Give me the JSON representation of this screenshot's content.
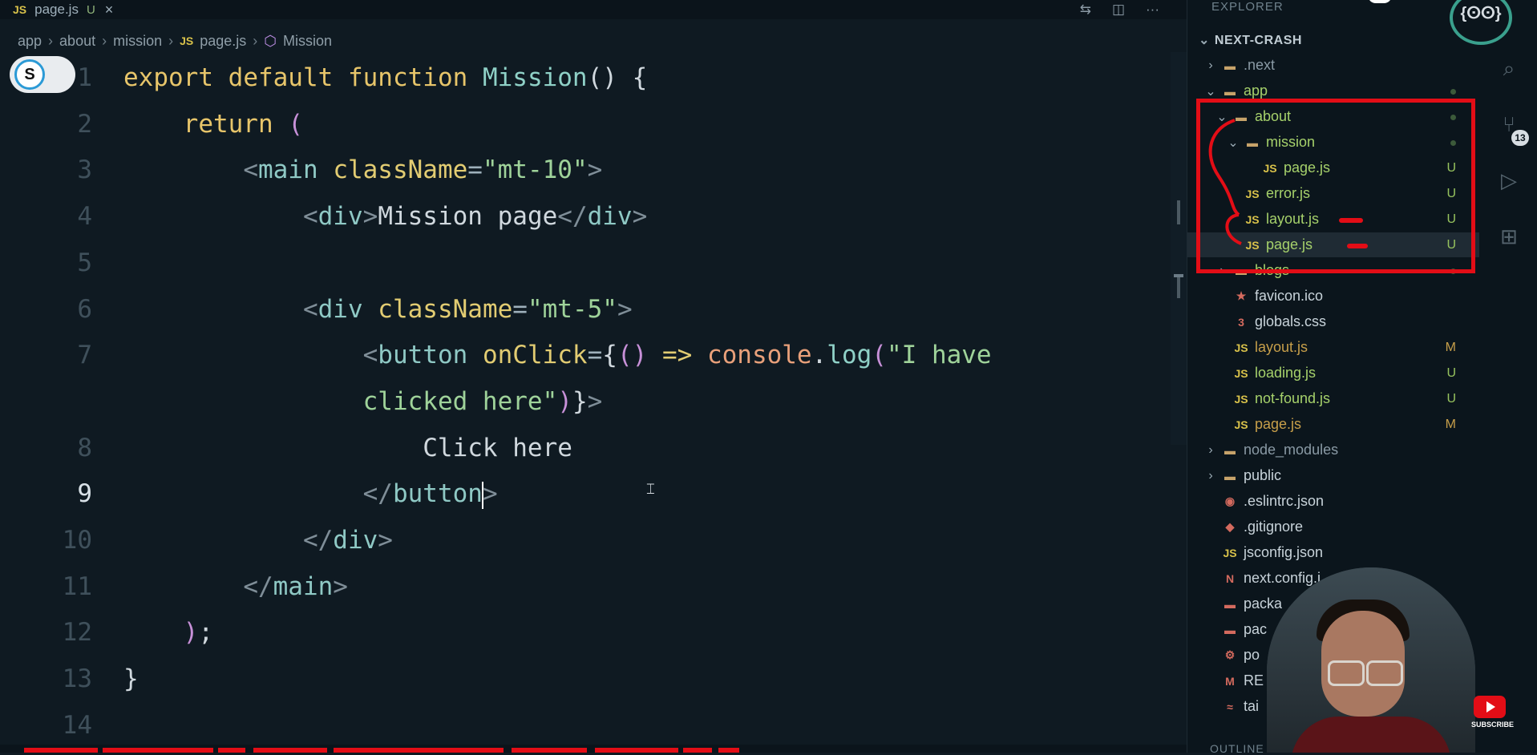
{
  "tab": {
    "icon": "JS",
    "name": "page.js",
    "status": "U",
    "close": "×"
  },
  "tab_actions": [
    "compare-icon",
    "split-editor-icon",
    "more-icon"
  ],
  "breadcrumb": [
    {
      "label": "app"
    },
    {
      "label": "about"
    },
    {
      "label": "mission"
    },
    {
      "label": "page.js",
      "icon": "JS"
    },
    {
      "label": "Mission",
      "icon": "symbol-icon"
    }
  ],
  "toggle": {
    "label": "S"
  },
  "code": {
    "active_line": 9,
    "lines": [
      {
        "n": "1",
        "tokens": [
          [
            "kw",
            "export "
          ],
          [
            "kw",
            "default "
          ],
          [
            "kw",
            "function "
          ],
          [
            "fn",
            "Mission"
          ],
          [
            "pl",
            "() {"
          ]
        ]
      },
      {
        "n": "2",
        "tokens": [
          [
            "pl",
            "    "
          ],
          [
            "kw",
            "return "
          ],
          [
            "pu",
            "("
          ]
        ]
      },
      {
        "n": "3",
        "tokens": [
          [
            "pl",
            "        "
          ],
          [
            "br",
            "<"
          ],
          [
            "tg",
            "main "
          ],
          [
            "at",
            "className"
          ],
          [
            "eq",
            "="
          ],
          [
            "st",
            "\"mt-10\""
          ],
          [
            "br",
            ">"
          ]
        ]
      },
      {
        "n": "4",
        "tokens": [
          [
            "pl",
            "            "
          ],
          [
            "br",
            "<"
          ],
          [
            "tg",
            "div"
          ],
          [
            "br",
            ">"
          ],
          [
            "pl",
            "Mission page"
          ],
          [
            "br",
            "</"
          ],
          [
            "tg",
            "div"
          ],
          [
            "br",
            ">"
          ]
        ]
      },
      {
        "n": "5",
        "tokens": []
      },
      {
        "n": "6",
        "tokens": [
          [
            "pl",
            "            "
          ],
          [
            "br",
            "<"
          ],
          [
            "tg",
            "div "
          ],
          [
            "at",
            "className"
          ],
          [
            "eq",
            "="
          ],
          [
            "st",
            "\"mt-5\""
          ],
          [
            "br",
            ">"
          ]
        ]
      },
      {
        "n": "7",
        "tokens": [
          [
            "pl",
            "                "
          ],
          [
            "br",
            "<"
          ],
          [
            "tg",
            "button "
          ],
          [
            "at",
            "onClick"
          ],
          [
            "eq",
            "="
          ],
          [
            "pl",
            "{"
          ],
          [
            "pu",
            "() "
          ],
          [
            "at",
            "=> "
          ],
          [
            "ar",
            "console"
          ],
          [
            "pl",
            "."
          ],
          [
            "fn",
            "log"
          ],
          [
            "pu",
            "("
          ],
          [
            "st",
            "\"I have"
          ]
        ]
      },
      {
        "n": "",
        "tokens": [
          [
            "pl",
            "                "
          ],
          [
            "st",
            "clicked here\""
          ],
          [
            "pu",
            ")"
          ],
          [
            "pl",
            "}"
          ],
          [
            "br",
            ">"
          ]
        ]
      },
      {
        "n": "8",
        "tokens": [
          [
            "pl",
            "                    Click here"
          ]
        ]
      },
      {
        "n": "9",
        "tokens": [
          [
            "pl",
            "                "
          ],
          [
            "br",
            "</"
          ],
          [
            "tg",
            "button"
          ],
          [
            "br",
            ">"
          ]
        ]
      },
      {
        "n": "10",
        "tokens": [
          [
            "pl",
            "            "
          ],
          [
            "br",
            "</"
          ],
          [
            "tg",
            "div"
          ],
          [
            "br",
            ">"
          ]
        ]
      },
      {
        "n": "11",
        "tokens": [
          [
            "pl",
            "        "
          ],
          [
            "br",
            "</"
          ],
          [
            "tg",
            "main"
          ],
          [
            "br",
            ">"
          ]
        ]
      },
      {
        "n": "12",
        "tokens": [
          [
            "pl",
            "    "
          ],
          [
            "pu",
            ")"
          ],
          [
            "pl",
            ";"
          ]
        ]
      },
      {
        "n": "13",
        "tokens": [
          [
            "pl",
            "}"
          ]
        ]
      },
      {
        "n": "14",
        "tokens": []
      }
    ]
  },
  "sidebar": {
    "title": "EXPLORER",
    "project": "NEXT-CRASH",
    "items": [
      {
        "name": ".next",
        "depth": 0,
        "type": "folder",
        "chev": "›",
        "icon": "next-folder-icon",
        "color": "#8a9aa5"
      },
      {
        "name": "app",
        "depth": 0,
        "type": "folder",
        "chev": "⌄",
        "icon": "app-folder-icon",
        "color": "#a6d16b",
        "dot": true
      },
      {
        "name": "about",
        "depth": 1,
        "type": "folder",
        "chev": "⌄",
        "icon": "folder-open-icon",
        "color": "#a6d16b",
        "dot": true
      },
      {
        "name": "mission",
        "depth": 2,
        "type": "folder",
        "chev": "⌄",
        "icon": "folder-open-icon",
        "color": "#a6d16b",
        "dot": true
      },
      {
        "name": "page.js",
        "depth": 3,
        "type": "file",
        "icon": "JS",
        "color": "#a6d16b",
        "status": "U"
      },
      {
        "name": "error.js",
        "depth": 2,
        "type": "file",
        "icon": "JS",
        "color": "#a6d16b",
        "status": "U"
      },
      {
        "name": "layout.js",
        "depth": 2,
        "type": "file",
        "icon": "JS",
        "color": "#a6d16b",
        "status": "U"
      },
      {
        "name": "page.js",
        "depth": 2,
        "type": "file",
        "icon": "JS",
        "color": "#a6d16b",
        "status": "U",
        "selected": true
      },
      {
        "name": "blogs",
        "depth": 1,
        "type": "folder",
        "chev": "›",
        "icon": "folder-icon",
        "color": "#a6d16b",
        "dot": true
      },
      {
        "name": "favicon.ico",
        "depth": 1,
        "type": "file",
        "icon": "★",
        "color": "#c8d3da"
      },
      {
        "name": "globals.css",
        "depth": 1,
        "type": "file",
        "icon": "3",
        "color": "#c8d3da"
      },
      {
        "name": "layout.js",
        "depth": 1,
        "type": "file",
        "icon": "JS",
        "color": "#c79f4a",
        "status": "M"
      },
      {
        "name": "loading.js",
        "depth": 1,
        "type": "file",
        "icon": "JS",
        "color": "#a6d16b",
        "status": "U"
      },
      {
        "name": "not-found.js",
        "depth": 1,
        "type": "file",
        "icon": "JS",
        "color": "#a6d16b",
        "status": "U"
      },
      {
        "name": "page.js",
        "depth": 1,
        "type": "file",
        "icon": "JS",
        "color": "#c79f4a",
        "status": "M"
      },
      {
        "name": "node_modules",
        "depth": 0,
        "type": "folder",
        "chev": "›",
        "icon": "node-folder-icon",
        "color": "#8a9aa5"
      },
      {
        "name": "public",
        "depth": 0,
        "type": "folder",
        "chev": "›",
        "icon": "public-folder-icon",
        "color": "#c8d3da"
      },
      {
        "name": ".eslintrc.json",
        "depth": 0,
        "type": "file",
        "icon": "◉",
        "color": "#c8d3da"
      },
      {
        "name": ".gitignore",
        "depth": 0,
        "type": "file",
        "icon": "◆",
        "color": "#c8d3da"
      },
      {
        "name": "jsconfig.json",
        "depth": 0,
        "type": "file",
        "icon": "JS",
        "color": "#c8d3da"
      },
      {
        "name": "next.config.j",
        "depth": 0,
        "type": "file",
        "icon": "N",
        "color": "#c8d3da"
      },
      {
        "name": "packa",
        "depth": 0,
        "type": "file",
        "icon": "▬",
        "color": "#c8d3da"
      },
      {
        "name": "pac",
        "depth": 0,
        "type": "file",
        "icon": "▬",
        "color": "#c8d3da"
      },
      {
        "name": "po",
        "depth": 0,
        "type": "file",
        "icon": "⚙",
        "color": "#c8d3da"
      },
      {
        "name": "RE",
        "depth": 0,
        "type": "file",
        "icon": "M",
        "color": "#c8d3da"
      },
      {
        "name": "tai",
        "depth": 0,
        "type": "file",
        "icon": "≈",
        "color": "#c8d3da"
      }
    ],
    "outline": "OUTLINE"
  },
  "activity_bar": {
    "items": [
      "search-icon",
      "source-control-icon",
      "run-debug-icon",
      "extensions-icon"
    ],
    "source_control_badge": "13"
  },
  "logo": "{ⵙⵙ}",
  "youtube": {
    "label": "SUBSCRIBE"
  }
}
